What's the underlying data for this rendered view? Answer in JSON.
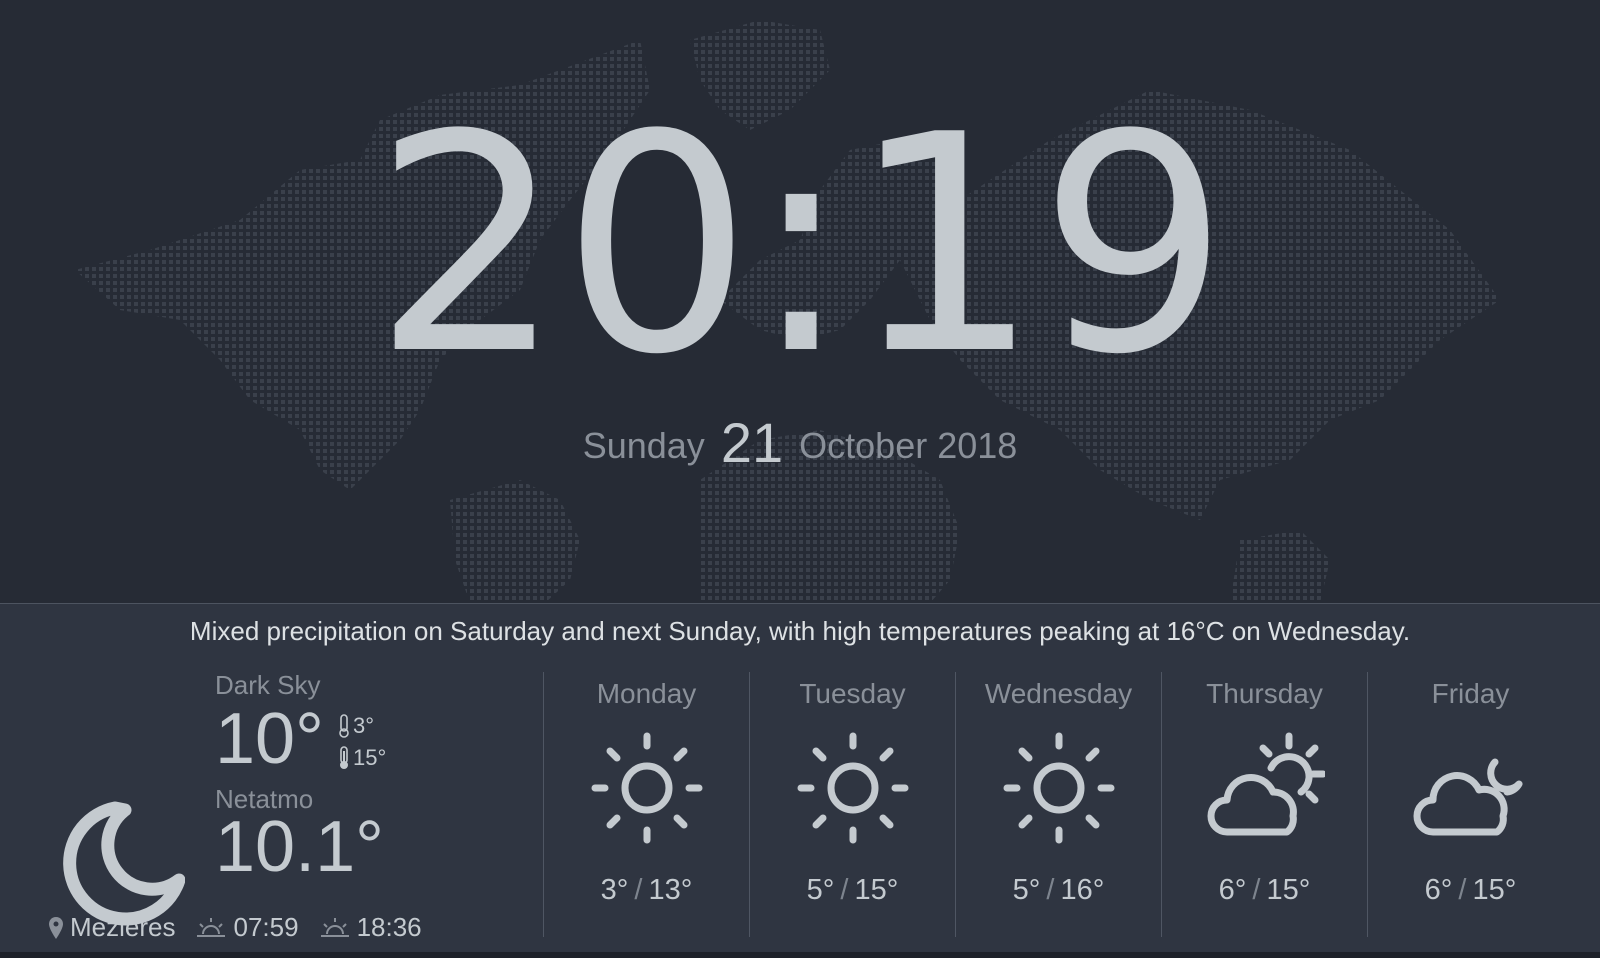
{
  "clock": {
    "time": "20:19"
  },
  "date": {
    "weekday": "Sunday",
    "day": "21",
    "month_year": "October 2018"
  },
  "weather": {
    "summary": "Mixed precipitation on Saturday and next Sunday, with high temperatures peaking at 16°C on Wednesday.",
    "current": {
      "source1": "Dark Sky",
      "temp1": "10°",
      "low": "3°",
      "high": "15°",
      "source2": "Netatmo",
      "temp2": "10.1°",
      "location": "Mezieres",
      "sunrise": "07:59",
      "sunset": "18:36",
      "icon": "moon-icon"
    },
    "forecast": [
      {
        "day": "Monday",
        "low": "3°",
        "high": "13°",
        "icon": "sun-icon"
      },
      {
        "day": "Tuesday",
        "low": "5°",
        "high": "15°",
        "icon": "sun-icon"
      },
      {
        "day": "Wednesday",
        "low": "5°",
        "high": "16°",
        "icon": "sun-icon"
      },
      {
        "day": "Thursday",
        "low": "6°",
        "high": "15°",
        "icon": "partly-cloudy-day-icon"
      },
      {
        "day": "Friday",
        "low": "6°",
        "high": "15°",
        "icon": "partly-cloudy-night-icon"
      }
    ],
    "separator": "/"
  },
  "colors": {
    "background": "#262b35",
    "panel": "#2f3541",
    "text": "#c4cacf",
    "muted": "#8a9099"
  }
}
